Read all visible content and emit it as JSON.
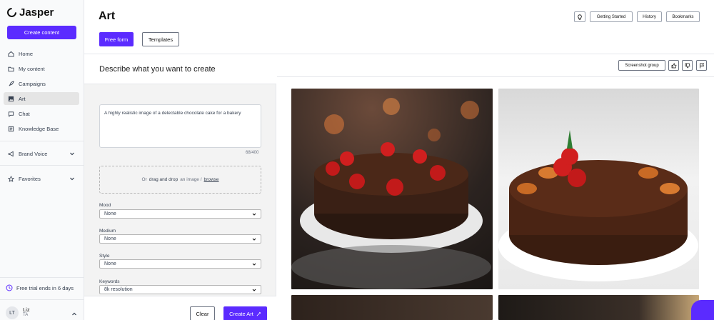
{
  "sidebar": {
    "brand": "Jasper",
    "create_button": "Create content",
    "items": [
      {
        "label": "Home"
      },
      {
        "label": "My content"
      },
      {
        "label": "Campaigns"
      },
      {
        "label": "Art"
      },
      {
        "label": "Chat"
      },
      {
        "label": "Knowledge Base"
      }
    ],
    "brand_voice": "Brand Voice",
    "favorites": "Favorites",
    "trial": "Free trial ends in 6 days",
    "user": {
      "initials": "LT",
      "name": "Liz",
      "sub": "TA"
    }
  },
  "header": {
    "title": "Art",
    "buttons": {
      "getting_started": "Getting Started",
      "history": "History",
      "bookmarks": "Bookmarks"
    },
    "tabs": {
      "free_form": "Free form",
      "templates": "Templates"
    }
  },
  "panel": {
    "title": "Describe what you want to create",
    "prompt": "A highly realistic image of a delectable chocolate cake for a bakery",
    "counter": "68/400",
    "dropzone": {
      "prefix": "Or",
      "strong": "drag and drop",
      "middle": "an image /",
      "link": "browse"
    },
    "fields": [
      {
        "label": "Mood",
        "value": "None"
      },
      {
        "label": "Medium",
        "value": "None"
      },
      {
        "label": "Style",
        "value": "None"
      },
      {
        "label": "Keywords",
        "value": "8k resolution"
      }
    ],
    "clear": "Clear",
    "create": "Create Art"
  },
  "results": {
    "screenshot_group": "Screenshot group"
  },
  "colors": {
    "accent": "#5b2bff"
  }
}
